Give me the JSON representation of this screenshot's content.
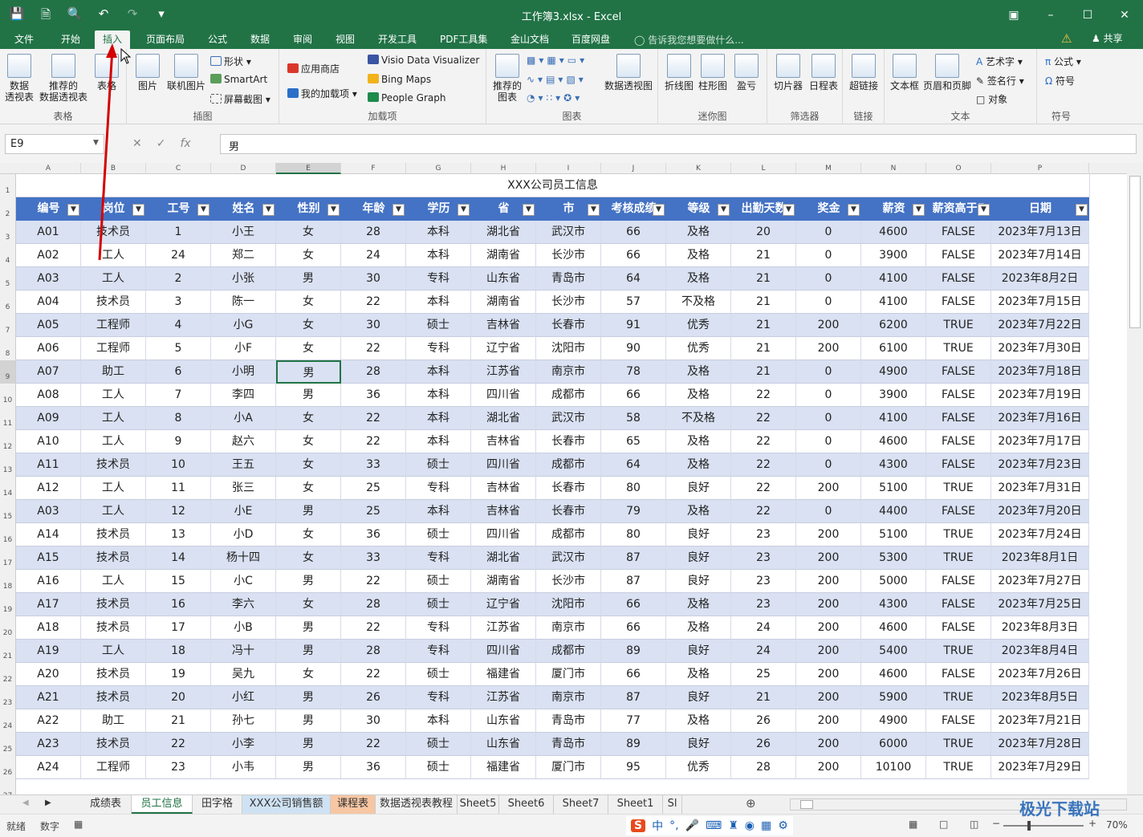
{
  "window": {
    "title": "工作簿3.xlsx - Excel"
  },
  "tabs": [
    "文件",
    "开始",
    "插入",
    "页面布局",
    "公式",
    "数据",
    "审阅",
    "视图",
    "开发工具",
    "PDF工具集",
    "金山文档",
    "百度网盘"
  ],
  "tell_me": "告诉我您想要做什么...",
  "share": "共享",
  "ribbon": {
    "tables": {
      "label": "表格",
      "buttons": [
        "数据\n透视表",
        "推荐的\n数据透视表",
        "表格"
      ]
    },
    "illustrations": {
      "label": "插图",
      "big": [
        "图片",
        "联机图片"
      ],
      "small": [
        "形状",
        "SmartArt",
        "屏幕截图"
      ]
    },
    "addins": {
      "label": "加载项",
      "small": [
        "应用商店",
        "我的加载项"
      ],
      "apps": [
        "Visio Data Visualizer",
        "Bing Maps",
        "People Graph"
      ]
    },
    "charts": {
      "label": "图表",
      "big": [
        "推荐的\n图表",
        "数据透视图"
      ]
    },
    "sparklines": {
      "label": "迷你图",
      "big": [
        "折线图",
        "柱形图",
        "盈亏"
      ]
    },
    "filters": {
      "label": "筛选器",
      "big": [
        "切片器",
        "日程表"
      ]
    },
    "links": {
      "label": "链接",
      "big": [
        "超链接"
      ]
    },
    "text": {
      "label": "文本",
      "big": [
        "文本框",
        "页眉和页脚"
      ],
      "small": [
        "艺术字",
        "签名行",
        "对象"
      ]
    },
    "symbols": {
      "label": "符号",
      "small": [
        "公式",
        "符号"
      ]
    }
  },
  "formula_bar": {
    "name_box": "E9",
    "value": "男"
  },
  "columns": [
    "A",
    "B",
    "C",
    "D",
    "E",
    "F",
    "G",
    "H",
    "I",
    "J",
    "K",
    "L",
    "M",
    "N",
    "O",
    "P"
  ],
  "sheet": {
    "title": "XXX公司员工信息",
    "headers": [
      "编号",
      "岗位",
      "工号",
      "姓名",
      "性别",
      "年龄",
      "学历",
      "省",
      "市",
      "考核成绩",
      "等级",
      "出勤天数",
      "奖金",
      "薪资",
      "薪资高于5",
      "日期"
    ],
    "rows": [
      [
        "A01",
        "技术员",
        "1",
        "小王",
        "女",
        "28",
        "本科",
        "湖北省",
        "武汉市",
        "66",
        "及格",
        "20",
        "0",
        "4600",
        "FALSE",
        "2023年7月13日"
      ],
      [
        "A02",
        "工人",
        "24",
        "郑二",
        "女",
        "24",
        "本科",
        "湖南省",
        "长沙市",
        "66",
        "及格",
        "21",
        "0",
        "3900",
        "FALSE",
        "2023年7月14日"
      ],
      [
        "A03",
        "工人",
        "2",
        "小张",
        "男",
        "30",
        "专科",
        "山东省",
        "青岛市",
        "64",
        "及格",
        "21",
        "0",
        "4100",
        "FALSE",
        "2023年8月2日"
      ],
      [
        "A04",
        "技术员",
        "3",
        "陈一",
        "女",
        "22",
        "本科",
        "湖南省",
        "长沙市",
        "57",
        "不及格",
        "21",
        "0",
        "4100",
        "FALSE",
        "2023年7月15日"
      ],
      [
        "A05",
        "工程师",
        "4",
        "小G",
        "女",
        "30",
        "硕士",
        "吉林省",
        "长春市",
        "91",
        "优秀",
        "21",
        "200",
        "6200",
        "TRUE",
        "2023年7月22日"
      ],
      [
        "A06",
        "工程师",
        "5",
        "小F",
        "女",
        "22",
        "专科",
        "辽宁省",
        "沈阳市",
        "90",
        "优秀",
        "21",
        "200",
        "6100",
        "TRUE",
        "2023年7月30日"
      ],
      [
        "A07",
        "助工",
        "6",
        "小明",
        "男",
        "28",
        "本科",
        "江苏省",
        "南京市",
        "78",
        "及格",
        "21",
        "0",
        "4900",
        "FALSE",
        "2023年7月18日"
      ],
      [
        "A08",
        "工人",
        "7",
        "李四",
        "男",
        "36",
        "本科",
        "四川省",
        "成都市",
        "66",
        "及格",
        "22",
        "0",
        "3900",
        "FALSE",
        "2023年7月19日"
      ],
      [
        "A09",
        "工人",
        "8",
        "小A",
        "女",
        "22",
        "本科",
        "湖北省",
        "武汉市",
        "58",
        "不及格",
        "22",
        "0",
        "4100",
        "FALSE",
        "2023年7月16日"
      ],
      [
        "A10",
        "工人",
        "9",
        "赵六",
        "女",
        "22",
        "本科",
        "吉林省",
        "长春市",
        "65",
        "及格",
        "22",
        "0",
        "4600",
        "FALSE",
        "2023年7月17日"
      ],
      [
        "A11",
        "技术员",
        "10",
        "王五",
        "女",
        "33",
        "硕士",
        "四川省",
        "成都市",
        "64",
        "及格",
        "22",
        "0",
        "4300",
        "FALSE",
        "2023年7月23日"
      ],
      [
        "A12",
        "工人",
        "11",
        "张三",
        "女",
        "25",
        "专科",
        "吉林省",
        "长春市",
        "80",
        "良好",
        "22",
        "200",
        "5100",
        "TRUE",
        "2023年7月31日"
      ],
      [
        "A03",
        "工人",
        "12",
        "小E",
        "男",
        "25",
        "本科",
        "吉林省",
        "长春市",
        "79",
        "及格",
        "22",
        "0",
        "4400",
        "FALSE",
        "2023年7月20日"
      ],
      [
        "A14",
        "技术员",
        "13",
        "小D",
        "女",
        "36",
        "硕士",
        "四川省",
        "成都市",
        "80",
        "良好",
        "23",
        "200",
        "5100",
        "TRUE",
        "2023年7月24日"
      ],
      [
        "A15",
        "技术员",
        "14",
        "杨十四",
        "女",
        "33",
        "专科",
        "湖北省",
        "武汉市",
        "87",
        "良好",
        "23",
        "200",
        "5300",
        "TRUE",
        "2023年8月1日"
      ],
      [
        "A16",
        "工人",
        "15",
        "小C",
        "男",
        "22",
        "硕士",
        "湖南省",
        "长沙市",
        "87",
        "良好",
        "23",
        "200",
        "5000",
        "FALSE",
        "2023年7月27日"
      ],
      [
        "A17",
        "技术员",
        "16",
        "李六",
        "女",
        "28",
        "硕士",
        "辽宁省",
        "沈阳市",
        "66",
        "及格",
        "23",
        "200",
        "4300",
        "FALSE",
        "2023年7月25日"
      ],
      [
        "A18",
        "技术员",
        "17",
        "小B",
        "男",
        "22",
        "专科",
        "江苏省",
        "南京市",
        "66",
        "及格",
        "24",
        "200",
        "4600",
        "FALSE",
        "2023年8月3日"
      ],
      [
        "A19",
        "工人",
        "18",
        "冯十",
        "男",
        "28",
        "专科",
        "四川省",
        "成都市",
        "89",
        "良好",
        "24",
        "200",
        "5400",
        "TRUE",
        "2023年8月4日"
      ],
      [
        "A20",
        "技术员",
        "19",
        "吴九",
        "女",
        "22",
        "硕士",
        "福建省",
        "厦门市",
        "66",
        "及格",
        "25",
        "200",
        "4600",
        "FALSE",
        "2023年7月26日"
      ],
      [
        "A21",
        "技术员",
        "20",
        "小红",
        "男",
        "26",
        "专科",
        "江苏省",
        "南京市",
        "87",
        "良好",
        "21",
        "200",
        "5900",
        "TRUE",
        "2023年8月5日"
      ],
      [
        "A22",
        "助工",
        "21",
        "孙七",
        "男",
        "30",
        "本科",
        "山东省",
        "青岛市",
        "77",
        "及格",
        "26",
        "200",
        "4900",
        "FALSE",
        "2023年7月21日"
      ],
      [
        "A23",
        "技术员",
        "22",
        "小李",
        "男",
        "22",
        "硕士",
        "山东省",
        "青岛市",
        "89",
        "良好",
        "26",
        "200",
        "6000",
        "TRUE",
        "2023年7月28日"
      ],
      [
        "A24",
        "工程师",
        "23",
        "小韦",
        "男",
        "36",
        "硕士",
        "福建省",
        "厦门市",
        "95",
        "优秀",
        "28",
        "200",
        "10100",
        "TRUE",
        "2023年7月29日"
      ]
    ]
  },
  "sheet_tabs": [
    "成绩表",
    "员工信息",
    "田字格",
    "XXX公司销售额",
    "课程表",
    "数据透视表教程",
    "Sheet5",
    "Sheet6",
    "Sheet7",
    "Sheet1",
    "Sl"
  ],
  "active_sheet": "员工信息",
  "status": {
    "ready": "就绪",
    "mode": "数字",
    "zoom": "70%"
  },
  "ime": "中",
  "watermark": "极光下载站",
  "colors": {
    "excel_green": "#217346",
    "header_blue": "#4472c4",
    "band_light": "#d9e1f2",
    "arrow_red": "#d40000"
  }
}
